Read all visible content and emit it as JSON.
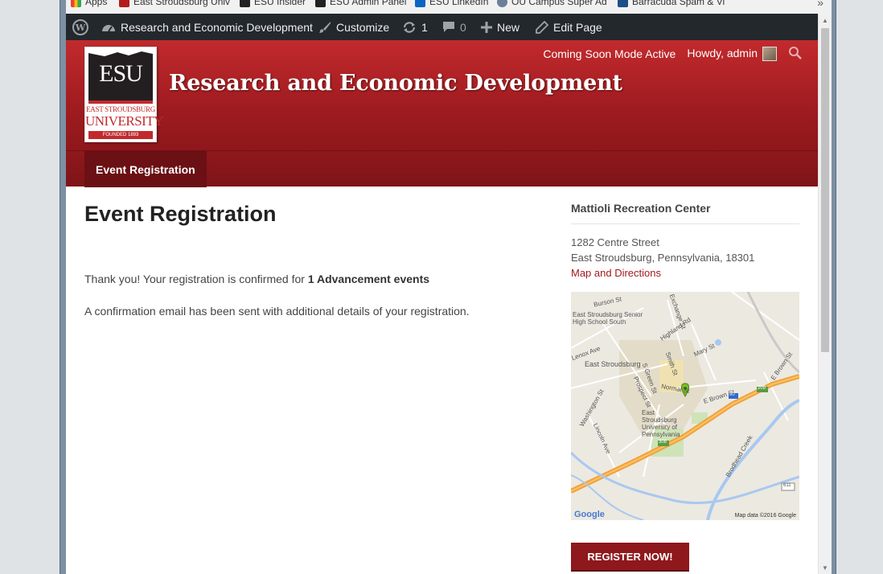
{
  "bookmarks": [
    {
      "label": "Apps",
      "color": "#4285f4"
    },
    {
      "label": "East Stroudsburg Univ",
      "color": "#b31b1b"
    },
    {
      "label": "ESU Insider",
      "color": "#222222"
    },
    {
      "label": "ESU Admin Panel",
      "color": "#222222"
    },
    {
      "label": "ESU LinkedIn",
      "color": "#0a66c2"
    },
    {
      "label": "OU Campus Super Ad",
      "color": "#6a7f99"
    },
    {
      "label": "Barracuda Spam & Vi",
      "color": "#1c4f8a"
    }
  ],
  "bookmarks_more": "»",
  "admin_bar": {
    "site_name": "Research and Economic Development",
    "customize": "Customize",
    "updates_count": "1",
    "comments_count": "0",
    "new_label": "New",
    "edit_label": "Edit Page"
  },
  "header": {
    "coming_soon": "Coming Soon Mode Active",
    "howdy": "Howdy, admin",
    "site_title": "Research and Economic Development",
    "logo": {
      "letters": "ESU",
      "line1": "EAST STROUDSBURG",
      "line2": "UNIVERSITY",
      "founded": "FOUNDED 1893"
    }
  },
  "nav": {
    "items": [
      "Event Registration"
    ]
  },
  "main": {
    "title": "Event Registration",
    "para1_prefix": "Thank you! Your registration is confirmed for ",
    "para1_bold": "1 Advancement events",
    "para2": "A confirmation email has been sent with additional details of your registration."
  },
  "sidebar": {
    "venue": "Mattioli Recreation Center",
    "street": "1282 Centre Street",
    "city": "East Stroudsburg, Pennsylvania, 18301",
    "map_link": "Map and Directions",
    "map_attribution": "Map data ©2016 Google",
    "map_logo": "Google",
    "map_labels": {
      "school": "East Stroudsburg Senior High School South",
      "town": "East Stroudsburg",
      "university": "East Stroudsburg University of Pennsylvania",
      "burson": "Burson St",
      "highland": "Highland Rd",
      "exchange": "Exchange St",
      "mary": "Mary St",
      "lenox": "Lenox Ave",
      "brown": "E Brown St",
      "washington": "Washington St",
      "lincoln": "Lincoln Ave",
      "prospect": "Prospect St",
      "green": "S Green St",
      "smith": "Smith St",
      "normal": "Normal St",
      "creek": "Brodhead Creek",
      "r80": "80",
      "r209": "209",
      "r308": "308",
      "r611": "611"
    },
    "register_button": "REGISTER NOW!"
  },
  "colors": {
    "brand_red": "#a01c20",
    "nav_dark": "#6b1014",
    "admin_bar": "#23282d",
    "link": "#a3191d"
  }
}
